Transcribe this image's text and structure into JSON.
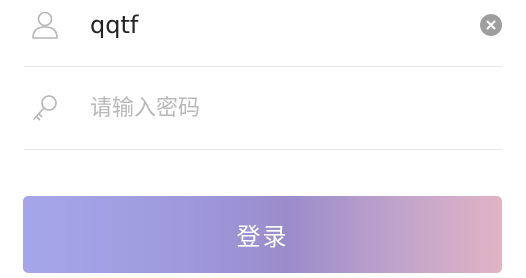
{
  "login_form": {
    "username": {
      "value": "qqtf",
      "icon": "user-icon"
    },
    "password": {
      "placeholder": "请输入密码",
      "value": "",
      "icon": "key-icon"
    },
    "clear_icon": "clear-icon",
    "submit_label": "登录"
  },
  "colors": {
    "button_gradient_start": "#a5a6ea",
    "button_gradient_mid": "#9a8ccb",
    "button_gradient_end": "#e0b4c4",
    "placeholder": "#b8b8b8",
    "divider": "#e6e6e6"
  }
}
